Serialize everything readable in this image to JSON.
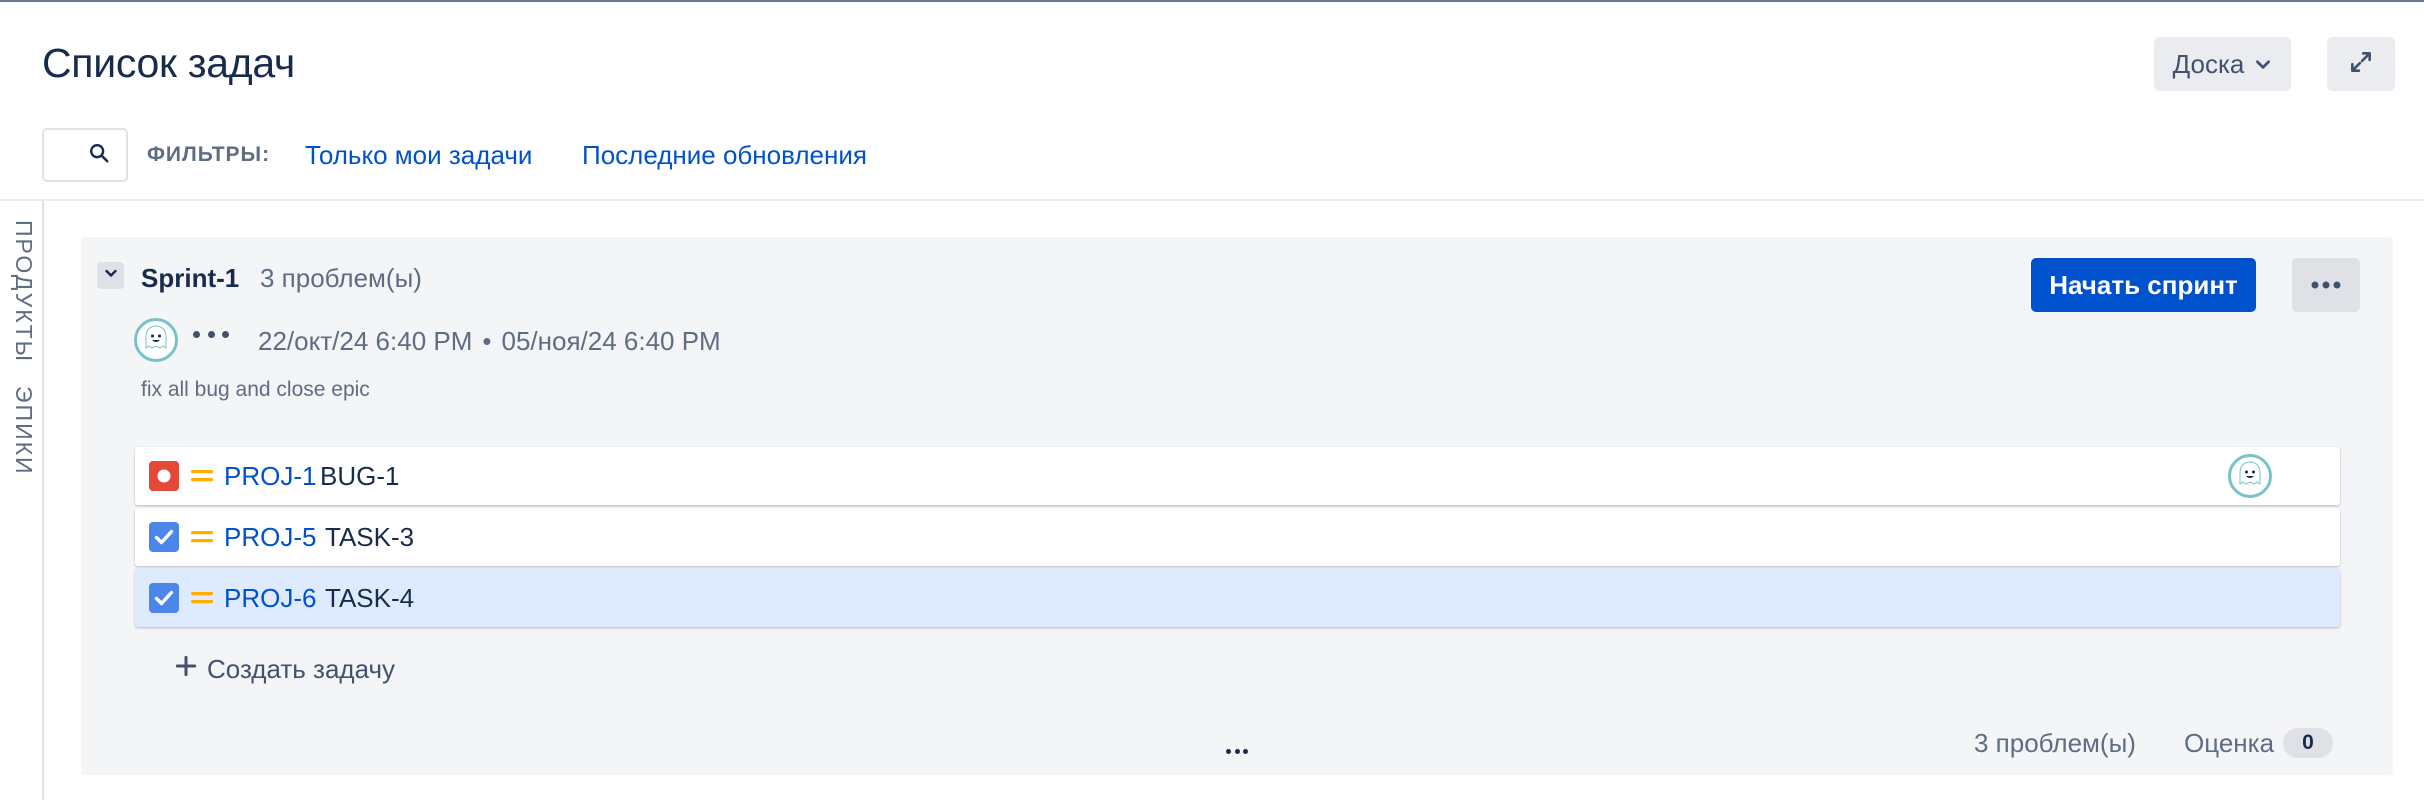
{
  "header": {
    "title": "Список задач",
    "board_button": "Доска"
  },
  "filters": {
    "label": "ФИЛЬТРЫ:",
    "only_my": "Только мои задачи",
    "recent": "Последние обновления"
  },
  "side_tabs": [
    "ПРОДУКТЫ",
    "ЭПИКИ"
  ],
  "sprint": {
    "name": "Sprint-1",
    "count": "3 проблем(ы)",
    "start_button": "Начать спринт",
    "start_date": "22/окт/24 6:40 PM",
    "date_separator": "•",
    "end_date": "05/ноя/24 6:40 PM",
    "goal": "fix all bug and close epic",
    "issues": [
      {
        "key": "PROJ-1",
        "summary": "BUG-1",
        "type": "bug",
        "priority": "medium"
      },
      {
        "key": "PROJ-5",
        "summary": "TASK-3",
        "type": "task",
        "priority": "medium"
      },
      {
        "key": "PROJ-6",
        "summary": "TASK-4",
        "type": "task",
        "priority": "medium"
      }
    ],
    "create_issue": "Создать задачу",
    "footer_count": "3 проблем(ы)",
    "estimate_label": "Оценка",
    "estimate_value": "0"
  },
  "colors": {
    "primary": "#0052cc",
    "bug": "#e5493a",
    "task": "#4bade8",
    "priority_medium": "#ffab00"
  },
  "icons": {
    "search": "search-icon",
    "board_chevron": "chevron-down-icon",
    "fullscreen": "expand-icon",
    "collapse": "chevron-down-icon",
    "more": "more-icon",
    "add": "plus-icon"
  }
}
